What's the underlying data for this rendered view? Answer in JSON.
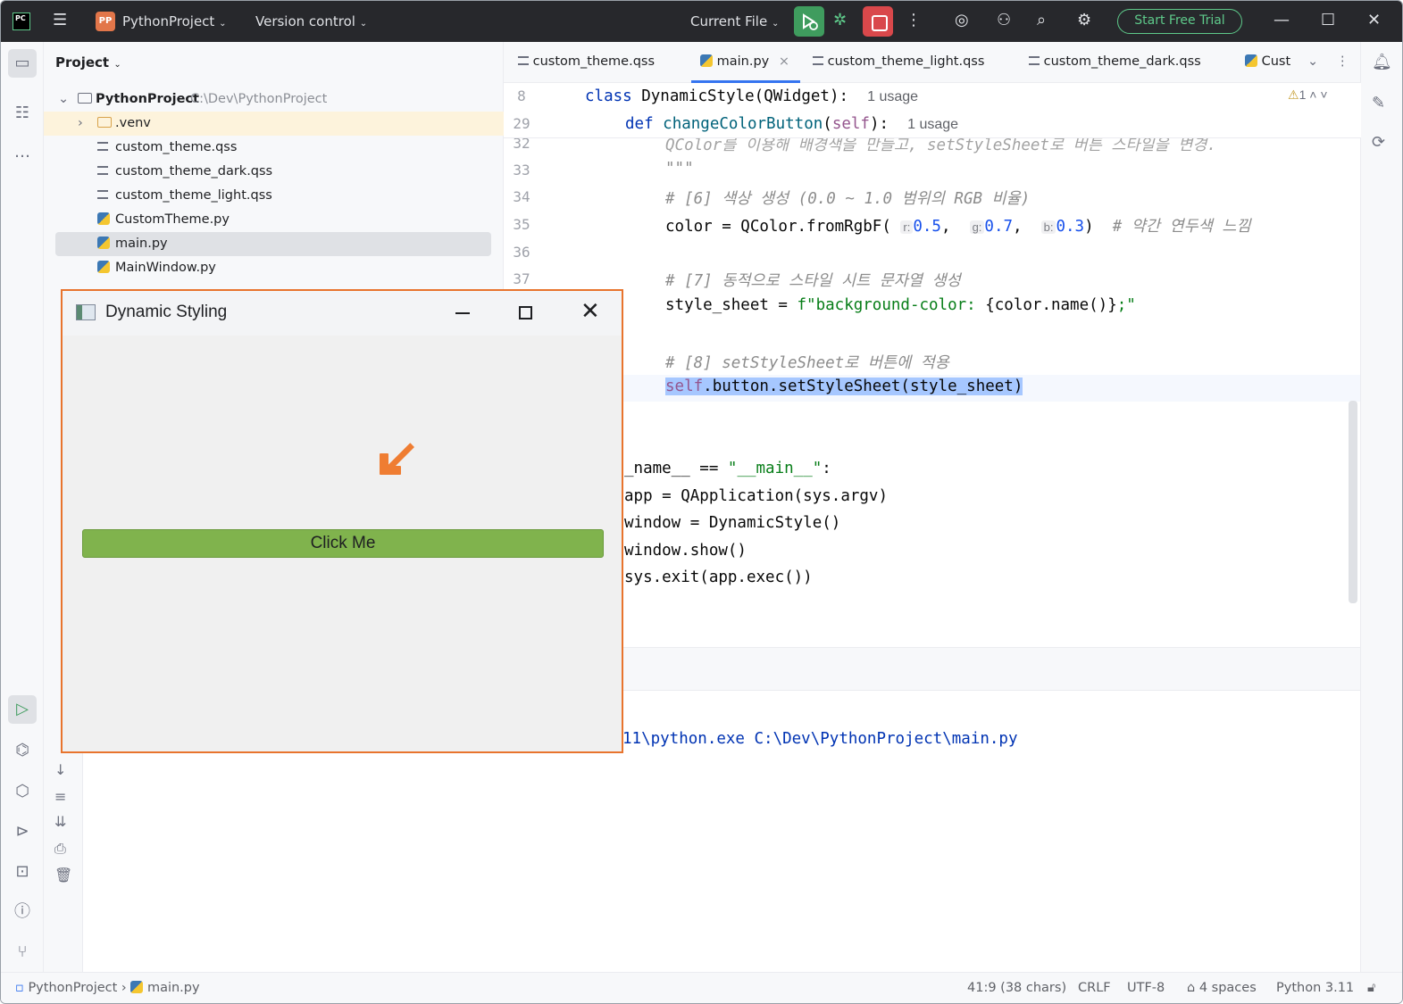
{
  "titlebar": {
    "app_logo": "PC",
    "project_badge": "PP",
    "project_name": "PythonProject",
    "version_control": "Version control",
    "run_config": "Current File",
    "trial_button": "Start Free Trial"
  },
  "project_panel": {
    "header": "Project",
    "root_name": "PythonProject",
    "root_path": "C:\\Dev\\PythonProject",
    "items": [
      {
        "label": ".venv",
        "kind": "folder"
      },
      {
        "label": "custom_theme.qss",
        "kind": "text"
      },
      {
        "label": "custom_theme_dark.qss",
        "kind": "text"
      },
      {
        "label": "custom_theme_light.qss",
        "kind": "text"
      },
      {
        "label": "CustomTheme.py",
        "kind": "python"
      },
      {
        "label": "main.py",
        "kind": "python",
        "selected": true
      },
      {
        "label": "MainWindow.py",
        "kind": "python"
      }
    ]
  },
  "tabs": [
    {
      "label": "custom_theme.qss"
    },
    {
      "label": "main.py",
      "active": true
    },
    {
      "label": "custom_theme_light.qss"
    },
    {
      "label": "custom_theme_dark.qss"
    },
    {
      "label": "Cust"
    }
  ],
  "editor": {
    "warnings": "1",
    "sticky": [
      {
        "line": "8",
        "usage": "1 usage"
      },
      {
        "line": "29",
        "usage": "1 usage"
      }
    ],
    "line_numbers": [
      "32",
      "33",
      "34",
      "35",
      "36",
      "37"
    ],
    "lines": {
      "l32": "QColor를 이용해 배경색을 만들고, setStyleSheet로 버튼 스타일을 변경.",
      "l33": "\"\"\"",
      "l34": "# [6] 색상 생성 (0.0 ~ 1.0 범위의 RGB 비율)",
      "l35_comment": "# 약간 연두색 느낌",
      "l37": "# [7] 동적으로 스타일 시트 문자열 생성",
      "l38_comment": "# [8] setStyleSheet로 버튼에 적용",
      "main_guard": "_name__ == \"__main__\":",
      "main_app": "app = QApplication(sys.argv)",
      "main_window": "window = DynamicStyle()",
      "main_show": "window.show()",
      "main_exit": "sys.exit(app.exec())"
    },
    "hint_r": "r:",
    "hint_g": "g:",
    "hint_b": "b:",
    "val_r": "0.5",
    "val_g": "0.7",
    "val_b": "0.3"
  },
  "console": {
    "command": "11\\python.exe C:\\Dev\\PythonProject\\main.py"
  },
  "qt_window": {
    "title": "Dynamic Styling",
    "button_label": "Click Me",
    "button_color": "#80b34d"
  },
  "statusbar": {
    "breadcrumb_project": "PythonProject",
    "breadcrumb_file": "main.py",
    "position": "41:9 (38 chars)",
    "line_sep": "CRLF",
    "encoding": "UTF-8",
    "indent": "4 spaces",
    "interpreter": "Python 3.11"
  },
  "colors": {
    "accent": "#3574f0",
    "trial": "#5ec98a",
    "stop": "#d9484b",
    "run": "#3f9c5e",
    "highlight_border": "#e8742d"
  }
}
